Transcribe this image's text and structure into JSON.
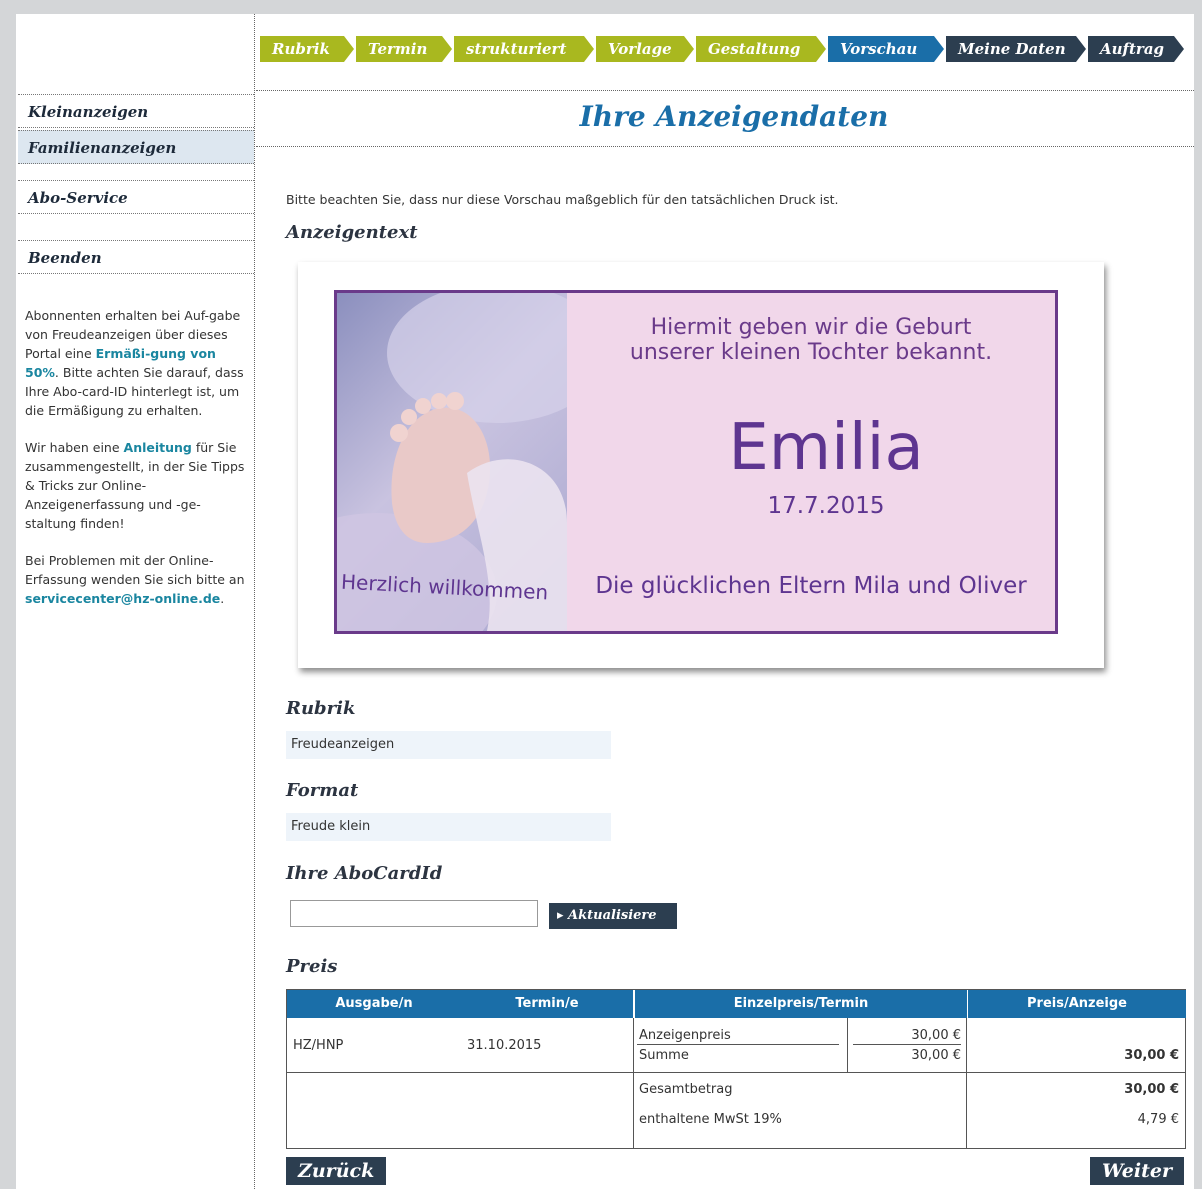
{
  "steps": [
    {
      "label": "Rubrik",
      "state": "done"
    },
    {
      "label": "Termin",
      "state": "done"
    },
    {
      "label": "strukturiert",
      "state": "done"
    },
    {
      "label": "Vorlage",
      "state": "done"
    },
    {
      "label": "Gestaltung",
      "state": "done"
    },
    {
      "label": "Vorschau",
      "state": "current"
    },
    {
      "label": "Meine Daten",
      "state": "todo"
    },
    {
      "label": "Auftrag",
      "state": "todo"
    }
  ],
  "sidebar": {
    "items": [
      {
        "label": "Kleinanzeigen"
      },
      {
        "label": "Familienanzeigen"
      },
      {
        "label": "Abo-Service"
      },
      {
        "label": "Beenden"
      }
    ],
    "p1_a": "Abonnenten erhalten bei Auf-gabe von Freudeanzeigen über dieses Portal eine ",
    "p1_link": "Ermäßi-gung von 50%",
    "p1_b": ". Bitte achten Sie darauf, dass Ihre Abo-card-ID hinterlegt ist, um die Ermäßigung zu erhalten.",
    "p2_a": "Wir haben eine ",
    "p2_link": "Anleitung",
    "p2_b": " für Sie zusammengestellt, in der Sie Tipps & Tricks zur Online-Anzeigenerfassung und -ge-staltung finden!",
    "p3_a": "Bei Problemen mit der Online-Erfassung wenden Sie sich bitte an ",
    "p3_link": "servicecenter@hz-online.de",
    "p3_b": "."
  },
  "main": {
    "title": "Ihre Anzeigendaten",
    "notice": "Bitte beachten Sie, dass nur diese Vorschau maßgeblich für den tatsächlichen Druck ist.",
    "ad_heading": "Anzeigentext",
    "ad": {
      "line1": "Hiermit geben wir die Geburt",
      "line2": "unserer kleinen Tochter bekannt.",
      "name": "Emilia",
      "date": "17.7.2015",
      "parents": "Die glücklichen Eltern Mila und Oliver",
      "welcome": "Herzlich willkommen"
    },
    "rubrik_heading": "Rubrik",
    "rubrik_value": "Freudeanzeigen",
    "format_heading": "Format",
    "format_value": "Freude klein",
    "abocard_heading": "Ihre AboCardId",
    "abocard_value": "",
    "update_label": "▸ Aktualisiere",
    "preis_heading": "Preis",
    "table": {
      "headers": [
        "Ausgabe/n",
        "Termin/e",
        "Einzelpreis/Termin",
        "Preis/Anzeige"
      ],
      "ausgabe": "HZ/HNP",
      "termin": "31.10.2015",
      "anzeigenpreis_label": "Anzeigenpreis",
      "anzeigenpreis_value": "30,00 €",
      "summe_label": "Summe",
      "summe_value": "30,00 €",
      "preis_anzeige": "30,00 €",
      "gesamt_label": "Gesamtbetrag",
      "gesamt_value": "30,00 €",
      "mwst_label": "enthaltene MwSt 19%",
      "mwst_value": "4,79 €"
    },
    "back_label": "Zurück",
    "next_label": "Weiter"
  }
}
